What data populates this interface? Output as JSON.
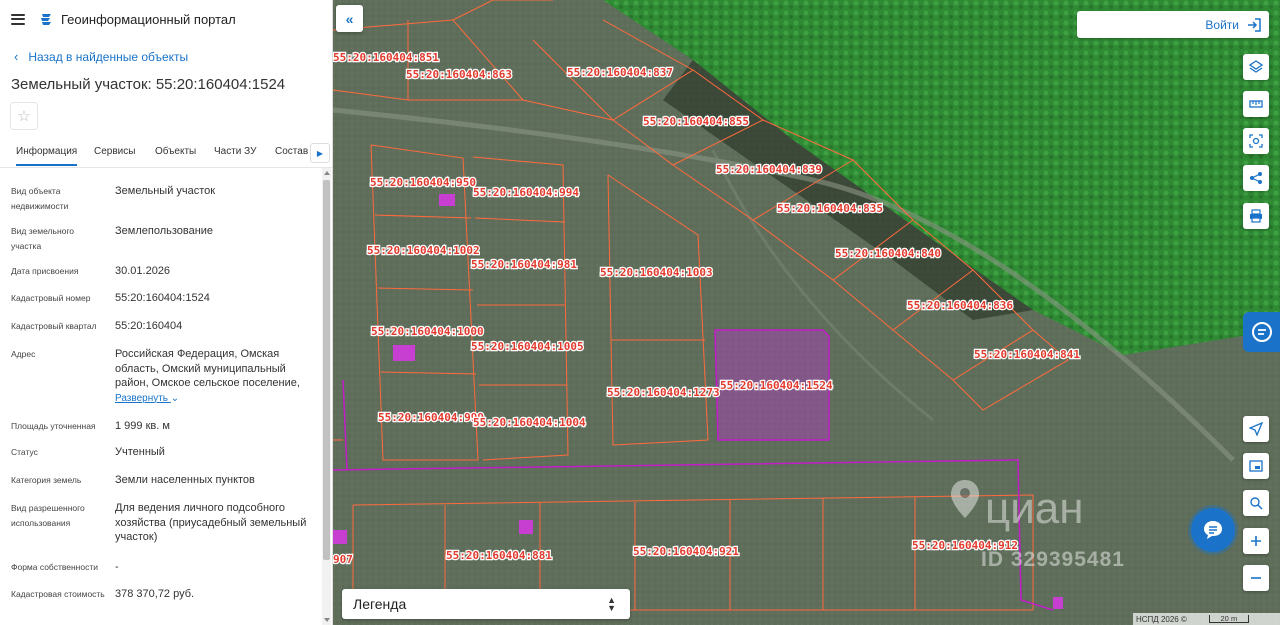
{
  "app": {
    "title": "Геоинформационный портал"
  },
  "nav": {
    "back_label": "Назад в найденные объекты"
  },
  "object": {
    "title": "Земельный участок: 55:20:160404:1524"
  },
  "tabs": [
    {
      "label": "Информация",
      "active": true
    },
    {
      "label": "Сервисы"
    },
    {
      "label": "Объекты"
    },
    {
      "label": "Части ЗУ"
    },
    {
      "label": "Состав"
    }
  ],
  "fields": [
    {
      "label": "Вид объекта недвижимости",
      "value": "Земельный участок"
    },
    {
      "label": "Вид земельного участка",
      "value": "Землепользование"
    },
    {
      "label": "Дата присвоения",
      "value": "30.01.2026"
    },
    {
      "label": "Кадастровый номер",
      "value": "55:20:160404:1524"
    },
    {
      "label": "Кадастровый квартал",
      "value": "55:20:160404"
    },
    {
      "label": "Адрес",
      "value": "Российская Федерация, Омская область, Омский муниципальный район, Омское сельское поселение,",
      "expand": "Развернуть"
    },
    {
      "label": "Площадь уточненная",
      "value": "1 999 кв. м"
    },
    {
      "label": "Статус",
      "value": "Учтенный"
    },
    {
      "label": "Категория земель",
      "value": "Земли населенных пунктов"
    },
    {
      "label": "Вид разрешенного использования",
      "value": "Для ведения личного подсобного хозяйства (приусадебный земельный участок)"
    },
    {
      "label": "Форма собственности",
      "value": "-"
    },
    {
      "label": "Кадастровая стоимость",
      "value": "378 370,72 руб."
    }
  ],
  "map": {
    "login_label": "Войти",
    "legend_label": "Легенда",
    "copyright": "НСПД 2026 ©",
    "scale_label": "20 m",
    "watermark_brand": "циан",
    "watermark_id": "ID 329395481",
    "parcels": [
      "55:20:160404:851",
      "55:20:160404:863",
      "55:20:160404:837",
      "55:20:160404:855",
      "55:20:160404:839",
      "55:20:160404:835",
      "55:20:160404:840",
      "55:20:160404:836",
      "55:20:160404:841",
      "55:20:160404:950",
      "55:20:160404:994",
      "55:20:160404:1002",
      "55:20:160404:981",
      "55:20:160404:1003",
      "55:20:160404:1000",
      "55:20:160404:1005",
      "55:20:160404:1273",
      "55:20:160404:1524",
      "55:20:160404:999",
      "55:20:160404:1004",
      "55:20:160404:881",
      "55:20:160404:921",
      "55:20:160404:912",
      "907"
    ],
    "colors": {
      "accent": "#1a73c8",
      "parcel_border": "#ff6a3d",
      "selected_border": "#c21cc9",
      "forest": "#2f8a34"
    }
  }
}
